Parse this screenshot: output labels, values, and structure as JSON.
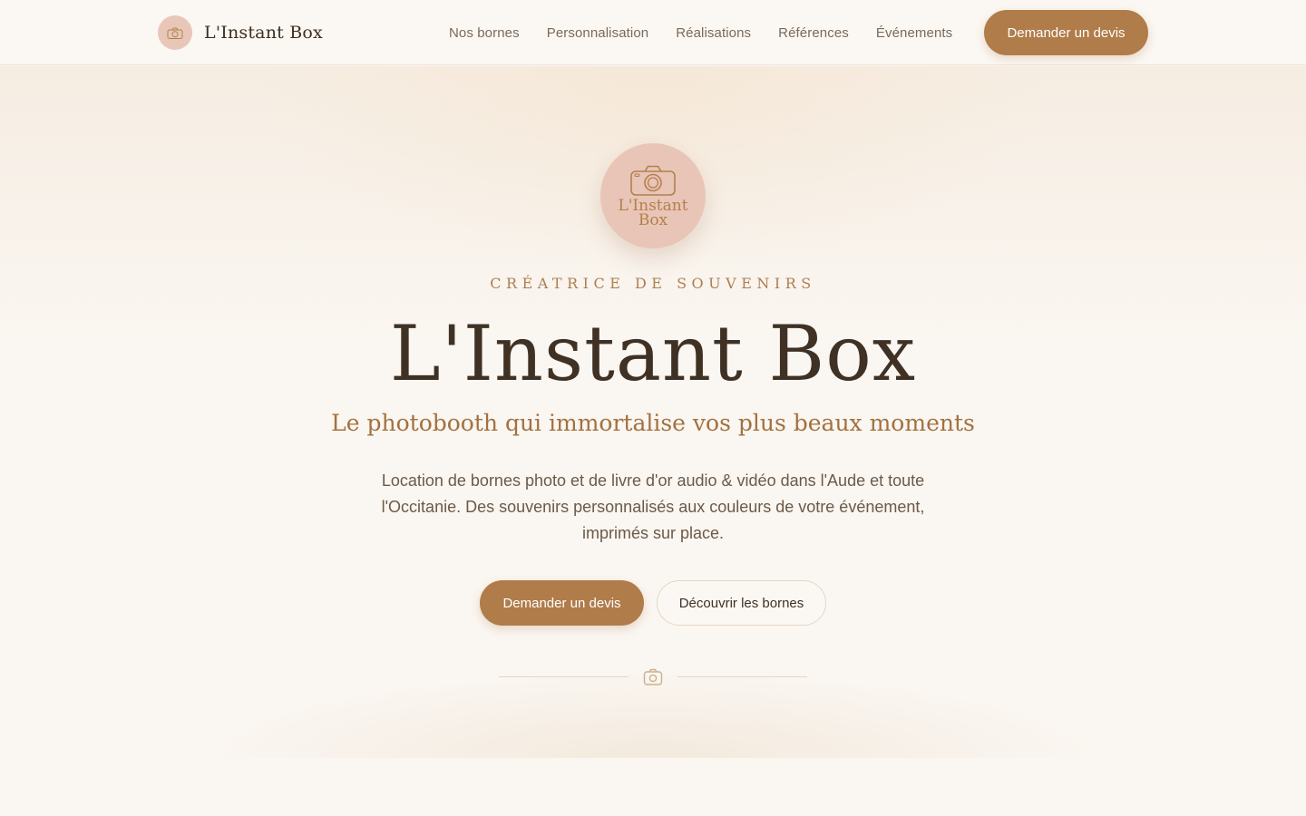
{
  "header": {
    "brand_name": "L'Instant Box",
    "nav": [
      {
        "label": "Nos bornes"
      },
      {
        "label": "Personnalisation"
      },
      {
        "label": "Réalisations"
      },
      {
        "label": "Références"
      },
      {
        "label": "Événements"
      }
    ],
    "cta_label": "Demander un devis"
  },
  "hero": {
    "logo_line1": "L'Instant",
    "logo_line2": "Box",
    "eyebrow": "CRÉATRICE DE SOUVENIRS",
    "title": "L'Instant Box",
    "subtitle": "Le photobooth qui immortalise vos plus beaux moments",
    "description": "Location de bornes photo et de livre d'or audio & vidéo dans l'Aude et toute l'Occitanie. Des souvenirs personnalisés aux couleurs de votre événement, imprimés sur place.",
    "primary_button": "Demander un devis",
    "secondary_button": "Découvrir les bornes"
  },
  "colors": {
    "accent": "#b07c4a",
    "logo_bg": "#e9c5b8",
    "text_dark": "#3f3124",
    "text_gold": "#a3713f",
    "background": "#faf6f1"
  },
  "icons": {
    "brand": "camera-icon",
    "divider": "camera-icon"
  }
}
